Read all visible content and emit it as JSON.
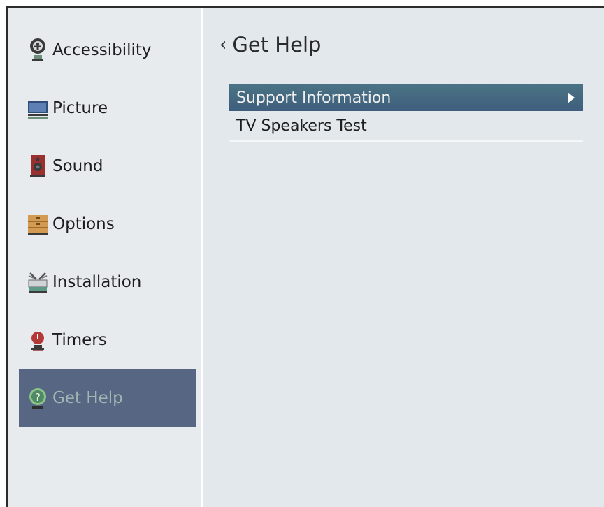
{
  "sidebar": {
    "items": [
      {
        "label": "Accessibility",
        "icon": "accessibility-icon"
      },
      {
        "label": "Picture",
        "icon": "picture-icon"
      },
      {
        "label": "Sound",
        "icon": "sound-icon"
      },
      {
        "label": "Options",
        "icon": "options-icon"
      },
      {
        "label": "Installation",
        "icon": "installation-icon"
      },
      {
        "label": "Timers",
        "icon": "timers-icon"
      },
      {
        "label": "Get Help",
        "icon": "get-help-icon",
        "selected": true
      }
    ]
  },
  "main": {
    "back_glyph": "‹",
    "title": "Get Help",
    "menu": [
      {
        "label": "Support Information",
        "selected": true
      },
      {
        "label": "TV Speakers Test"
      }
    ]
  },
  "colors": {
    "selection": "#566683",
    "highlight": "#3f5e7d",
    "background": "#e3e8ec"
  }
}
